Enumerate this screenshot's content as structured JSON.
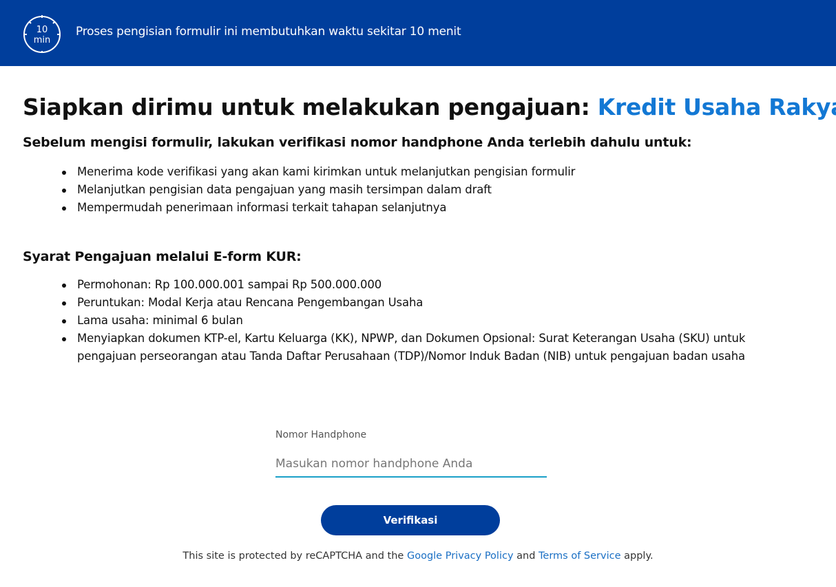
{
  "banner": {
    "timer_number": "10",
    "timer_unit": "min",
    "text": "Proses pengisian formulir ini membutuhkan waktu sekitar 10 menit",
    "color": "#003e9c",
    "icon": "timer-icon"
  },
  "headline": {
    "prefix": "Siapkan dirimu untuk melakukan pengajuan: ",
    "accent": "Kredit Usaha Rakyat",
    "accent_color": "#1378d4"
  },
  "verification_section": {
    "heading": "Sebelum mengisi formulir, lakukan verifikasi nomor handphone Anda terlebih dahulu untuk:",
    "items": [
      "Menerima kode verifikasi yang akan kami kirimkan untuk melanjutkan pengisian formulir",
      "Melanjutkan pengisian data pengajuan yang masih tersimpan dalam draft",
      "Mempermudah penerimaan informasi terkait tahapan selanjutnya"
    ]
  },
  "requirements_section": {
    "heading": "Syarat Pengajuan melalui E-form KUR:",
    "items": [
      "Permohonan: Rp 100.000.001 sampai Rp 500.000.000",
      "Peruntukan: Modal Kerja atau Rencana Pengembangan Usaha",
      "Lama usaha: minimal 6 bulan",
      "Menyiapkan dokumen KTP-el, Kartu Keluarga (KK), NPWP, dan Dokumen Opsional: Surat Keterangan Usaha (SKU) untuk pengajuan perseorangan atau Tanda Daftar Perusahaan (TDP)/Nomor Induk Badan (NIB) untuk pengajuan badan usaha"
    ]
  },
  "phone_form": {
    "label": "Nomor Handphone",
    "value": "",
    "placeholder": "Masukan nomor handphone Anda",
    "underline_color": "#1aa0c8",
    "button_label": "Verifikasi"
  },
  "recaptcha": {
    "prefix": "This site is protected by reCAPTCHA and the ",
    "privacy_link": "Google Privacy Policy",
    "middle": " and ",
    "terms_link": "Terms of Service",
    "suffix": " apply.",
    "link_color": "#1a6fc4"
  }
}
